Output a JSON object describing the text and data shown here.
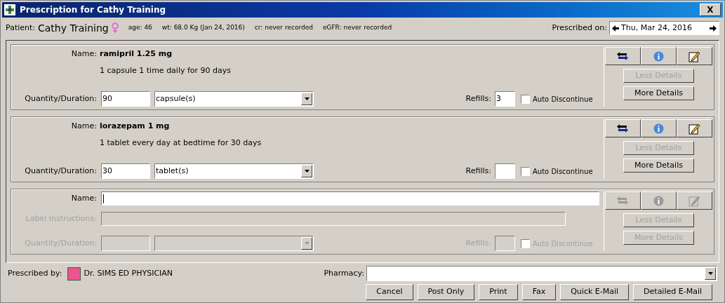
{
  "window": {
    "title": "Prescription for Cathy Training",
    "close": "X"
  },
  "patient": {
    "label": "Patient:",
    "name": "Cathy Training",
    "age": "age: 46",
    "weight": "wt: 68.0 Kg (Jan 24, 2016)",
    "cr": "cr: never recorded",
    "egfr": "eGFR: never recorded"
  },
  "prescribed_on": {
    "label": "Prescribed on:",
    "value": "Thu, Mar 24, 2016"
  },
  "prescriptions": [
    {
      "kind": "drug",
      "disabled": false,
      "name_label": "Name:",
      "name": "ramipril 1.25 mg",
      "sig": "1 capsule 1 time daily for 90 days",
      "quantity_label": "Quantity/Duration:",
      "quantity": "90",
      "unit": "capsule(s)",
      "refills_label": "Refills:",
      "refills": "3",
      "auto_discontinue": {
        "label": "Auto Discontinue",
        "checked": false
      },
      "less_details": {
        "label": "Less Details",
        "disabled": true
      },
      "more_details": {
        "label": "More Details",
        "disabled": false
      }
    },
    {
      "kind": "drug",
      "disabled": false,
      "name_label": "Name:",
      "name": "lorazepam 1 mg",
      "sig": "1 tablet every day at bedtime for 30 days",
      "quantity_label": "Quantity/Duration:",
      "quantity": "30",
      "unit": "tablet(s)",
      "refills_label": "Refills:",
      "auto_discontinue": {
        "label": "Auto Discontinue",
        "checked": false
      },
      "less_details": {
        "label": "Less Details",
        "disabled": true
      },
      "more_details": {
        "label": "More Details",
        "disabled": false
      }
    },
    {
      "kind": "new",
      "disabled": true,
      "name_label": "Name:",
      "label_instructions_label": "Label Instructions:",
      "quantity_label": "Quantity/Duration:",
      "refills_label": "Refills:",
      "auto_discontinue": {
        "label": "Auto Discontinue",
        "checked": false
      },
      "less_details": {
        "label": "Less Details",
        "disabled": true
      },
      "more_details": {
        "label": "More Details",
        "disabled": true
      }
    }
  ],
  "prescribed_by": {
    "label": "Prescribed by:",
    "name": "Dr. SIMS ED PHYSICIAN",
    "color": "#e8568f"
  },
  "pharmacy": {
    "label": "Pharmacy:"
  },
  "buttons": [
    "Cancel",
    "Post Only",
    "Print",
    "Fax",
    "Quick E-Mail",
    "Detailed E-Mail"
  ]
}
